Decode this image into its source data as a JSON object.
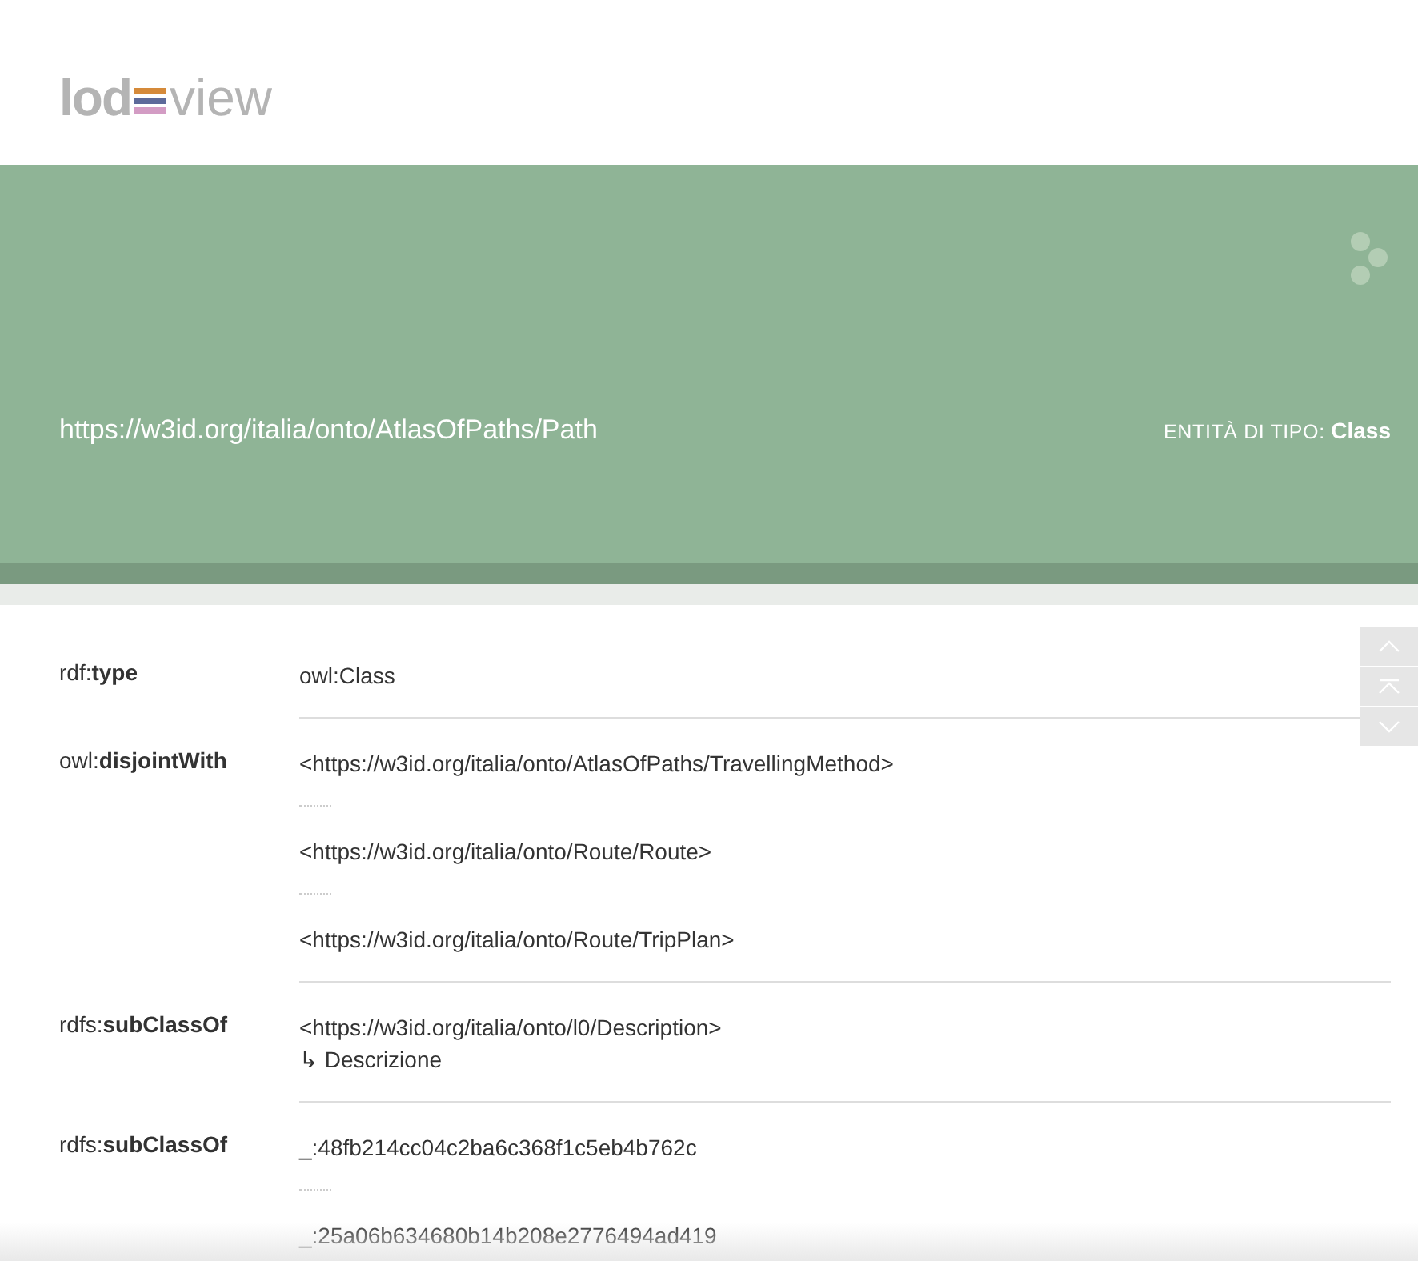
{
  "logo": {
    "bold": "lod",
    "light": "view"
  },
  "header": {
    "uri": "https://w3id.org/italia/onto/AtlasOfPaths/Path",
    "type_label": "ENTITÀ DI TIPO:",
    "type_value": "Class"
  },
  "properties": [
    {
      "prefix": "rdf:",
      "name": "type",
      "values": [
        {
          "text": "owl:Class"
        }
      ]
    },
    {
      "prefix": "owl:",
      "name": "disjointWith",
      "values": [
        {
          "text": "<https://w3id.org/italia/onto/AtlasOfPaths/TravellingMethod>"
        },
        {
          "text": "<https://w3id.org/italia/onto/Route/Route>"
        },
        {
          "text": "<https://w3id.org/italia/onto/Route/TripPlan>"
        }
      ]
    },
    {
      "prefix": "rdfs:",
      "name": "subClassOf",
      "values": [
        {
          "text": "<https://w3id.org/italia/onto/l0/Description>",
          "label": "↳ Descrizione"
        }
      ]
    },
    {
      "prefix": "rdfs:",
      "name": "subClassOf",
      "values": [
        {
          "text": "_:48fb214cc04c2ba6c368f1c5eb4b762c"
        },
        {
          "text": "_:25a06b634680b14b208e2776494ad419"
        }
      ]
    }
  ]
}
